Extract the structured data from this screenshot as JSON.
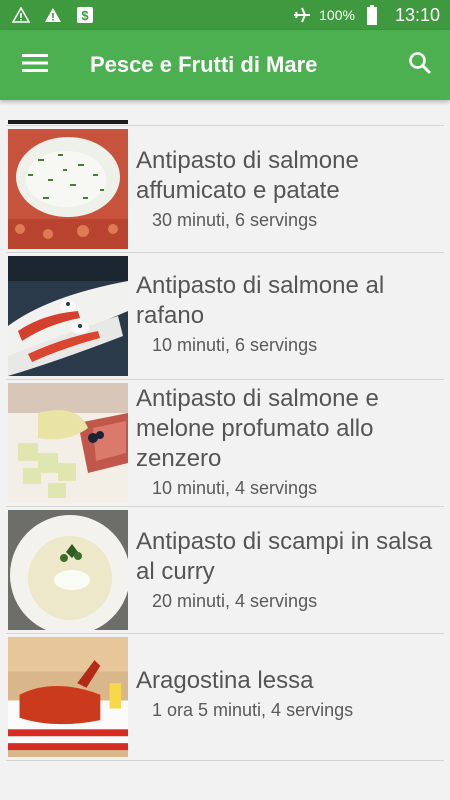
{
  "status": {
    "battery": "100%",
    "time": "13:10",
    "icons": [
      "warning-icon",
      "warning-icon",
      "money-icon",
      "airplane-icon",
      "battery-icon"
    ]
  },
  "appbar": {
    "title": "Pesce e Frutti di Mare",
    "menu_icon": "menu-icon",
    "search_icon": "search-icon",
    "color": "#4caf50"
  },
  "recipes": [
    {
      "name": "Antipasto di salmone affumicato e patate",
      "meta": "30 minuti, 6 servings"
    },
    {
      "name": "Antipasto di salmone al rafano",
      "meta": "10 minuti, 6 servings"
    },
    {
      "name": "Antipasto di salmone e melone profumato allo zenzero",
      "meta": "10 minuti, 4 servings"
    },
    {
      "name": "Antipasto di scampi in salsa al curry",
      "meta": "20 minuti, 4 servings"
    },
    {
      "name": "Aragostina lessa",
      "meta": "1 ora 5 minuti, 4 servings"
    }
  ]
}
